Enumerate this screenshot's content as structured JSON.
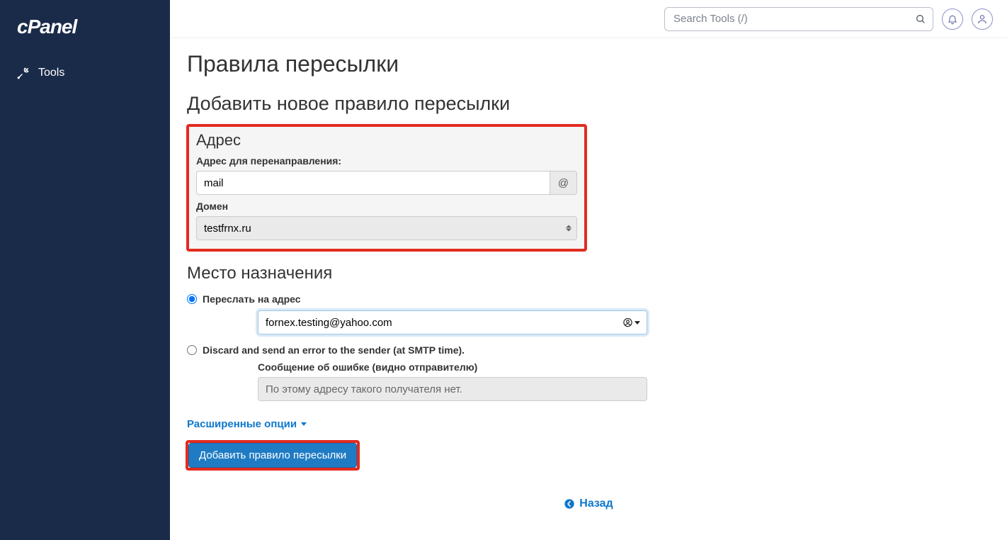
{
  "brand": "cPanel",
  "sidebar": {
    "items": [
      {
        "label": "Tools"
      }
    ]
  },
  "topbar": {
    "search_placeholder": "Search Tools (/)"
  },
  "page": {
    "title": "Правила пересылки",
    "subtitle": "Добавить новое правило пересылки"
  },
  "address_box": {
    "heading": "Адрес",
    "forward_label": "Адрес для перенаправления:",
    "forward_value": "mail",
    "at_symbol": "@",
    "domain_label": "Домен",
    "domain_value": "testfrnx.ru"
  },
  "destination": {
    "heading": "Место назначения",
    "option_forward": "Переслать на адрес",
    "forward_email_value": "fornex.testing@yahoo.com",
    "option_discard": "Discard and send an error to the sender (at SMTP time).",
    "error_msg_label": "Сообщение об ошибке (видно отправителю)",
    "error_msg_value": "По этому адресу такого получателя нет."
  },
  "advanced_label": "Расширенные опции",
  "submit_label": "Добавить правило пересылки",
  "back_label": "Назад"
}
